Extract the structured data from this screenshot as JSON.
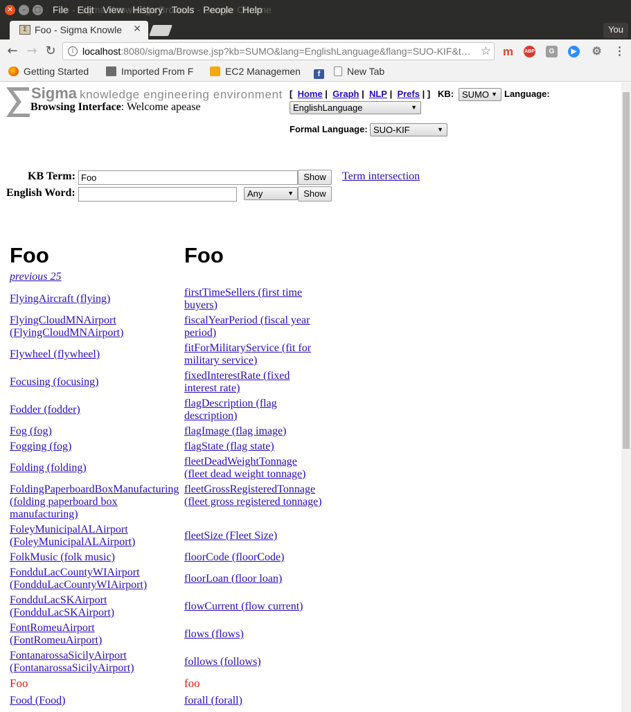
{
  "browser": {
    "menu": [
      "File",
      "Edit",
      "View",
      "History",
      "Tools",
      "People",
      "Help"
    ],
    "ghost_title": "Foo - Sigma Knowledge Browser - Google Chrome",
    "tab_title": "Foo - Sigma Knowle",
    "profile": "You",
    "url_host": "localhost",
    "url_rest": ":8080/sigma/Browse.jsp?kb=SUMO&lang=EnglishLanguage&flang=SUO-KIF&t…",
    "bookmarks": [
      "Getting Started",
      "Imported From F",
      "EC2 Managemen",
      "New Tab"
    ]
  },
  "header": {
    "brand_word": "Sigma",
    "brand_tagline": "knowledge engineering environment",
    "browsing_label": "Browsing Interface",
    "welcome": ": Welcome apease",
    "links": [
      "Home",
      "Graph",
      "NLP",
      "Prefs"
    ],
    "kb_label": "KB:",
    "kb_value": "SUMO",
    "language_label": "Language:",
    "language_value": "EnglishLanguage",
    "formal_label": "Formal Language:",
    "formal_value": "SUO-KIF"
  },
  "search": {
    "kb_term_label": "KB Term:",
    "kb_term_value": "Foo",
    "show_label": "Show",
    "english_word_label": "English Word:",
    "english_word_value": "",
    "pos_value": "Any",
    "term_intersection": "Term intersection"
  },
  "results": {
    "left_heading": "Foo",
    "right_heading": "Foo",
    "previous": "previous 25",
    "left": [
      {
        "text": "FlyingAircraft (flying)"
      },
      {
        "text": "FlyingCloudMNAirport (FlyingCloudMNAirport)"
      },
      {
        "text": "Flywheel (flywheel)"
      },
      {
        "text": "Focusing (focusing)"
      },
      {
        "text": "Fodder (fodder)"
      },
      {
        "text": "Fog (fog)"
      },
      {
        "text": "Fogging (fog)"
      },
      {
        "text": "Folding (folding)"
      },
      {
        "text": "FoldingPaperboardBoxManufacturing (folding paperboard box manufacturing)"
      },
      {
        "text": "FoleyMunicipalALAirport (FoleyMunicipalALAirport)"
      },
      {
        "text": "FolkMusic (folk music)"
      },
      {
        "text": "FondduLacCountyWIAirport (FondduLacCountyWIAirport)"
      },
      {
        "text": "FondduLacSKAirport (FondduLacSKAirport)"
      },
      {
        "text": "FontRomeuAirport (FontRomeuAirport)"
      },
      {
        "text": "FontanarossaSicilyAirport (FontanarossaSicilyAirport)"
      },
      {
        "text": "Foo"
      },
      {
        "text": "Food (Food)"
      }
    ],
    "right": [
      {
        "text": "firstTimeSellers (first time buyers)"
      },
      {
        "text": "fiscalYearPeriod (fiscal year period)"
      },
      {
        "text": "fitForMilitaryService (fit for military service)"
      },
      {
        "text": "fixedInterestRate (fixed interest rate)"
      },
      {
        "text": "flagDescription (flag description)"
      },
      {
        "text": "flagImage (flag image)"
      },
      {
        "text": "flagState (flag state)"
      },
      {
        "text": "fleetDeadWeightTonnage (fleet dead weight tonnage)"
      },
      {
        "text": "fleetGrossRegisteredTonnage (fleet gross registered tonnage)"
      },
      {
        "text": "fleetSize (Fleet Size)"
      },
      {
        "text": "floorCode (floorCode)"
      },
      {
        "text": "floorLoan (floor loan)"
      },
      {
        "text": "flowCurrent (flow current)"
      },
      {
        "text": "flows (flows)"
      },
      {
        "text": "follows (follows)"
      },
      {
        "text": "foo"
      },
      {
        "text": "forall (forall)"
      }
    ]
  }
}
